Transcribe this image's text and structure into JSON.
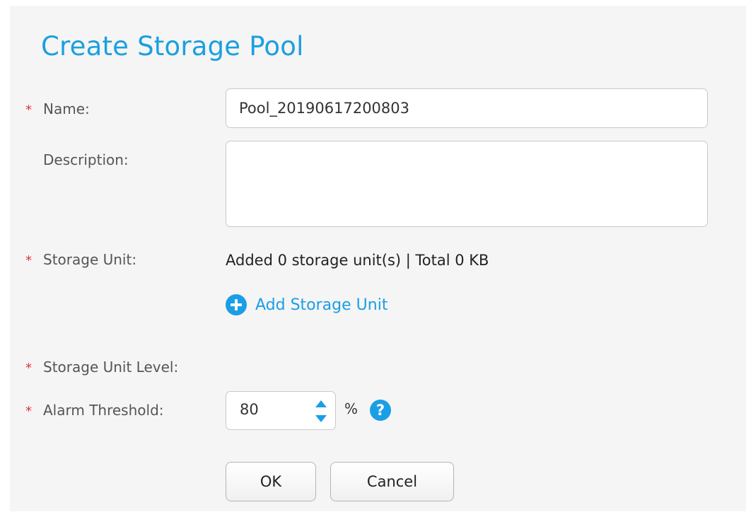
{
  "dialog": {
    "title": "Create Storage Pool"
  },
  "form": {
    "required_marker": "*",
    "name": {
      "label": "Name:",
      "value": "Pool_20190617200803"
    },
    "description": {
      "label": "Description:",
      "value": ""
    },
    "storage_unit": {
      "label": "Storage Unit:",
      "summary": "Added 0 storage unit(s) | Total 0 KB",
      "add_link": "Add Storage Unit"
    },
    "storage_unit_level": {
      "label": "Storage Unit Level:"
    },
    "alarm_threshold": {
      "label": "Alarm Threshold:",
      "value": "80",
      "unit": "%",
      "help": "?"
    }
  },
  "buttons": {
    "ok": "OK",
    "cancel": "Cancel"
  },
  "colors": {
    "accent": "#1a9ee6",
    "required": "#e0323c"
  },
  "icons": {
    "add": "plus-circle-icon",
    "help": "question-circle-icon",
    "step_up": "caret-up-icon",
    "step_down": "caret-down-icon"
  }
}
